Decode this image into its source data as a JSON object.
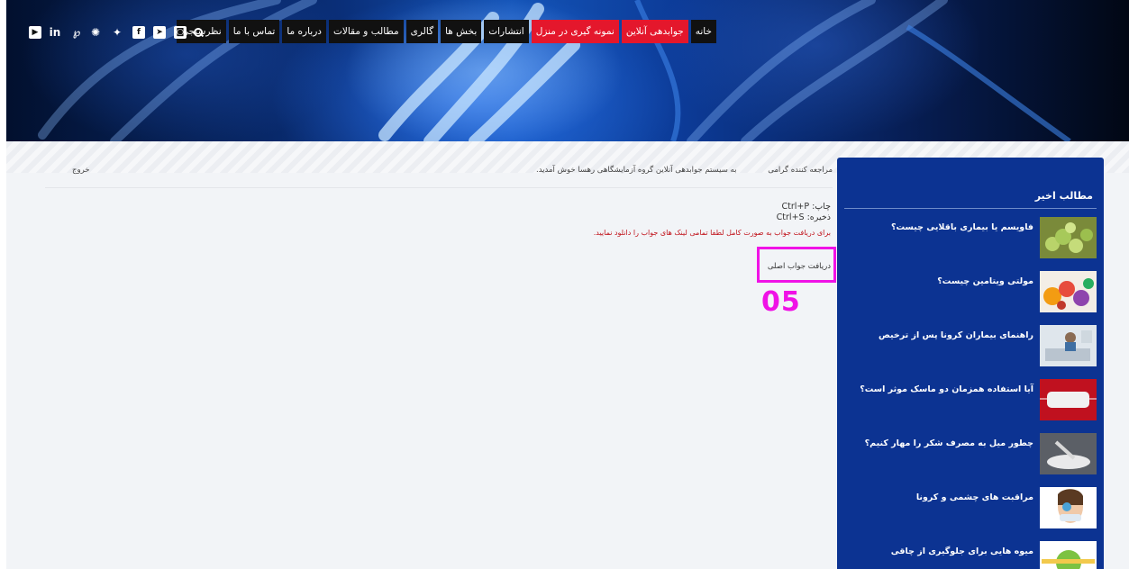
{
  "nav": {
    "items": [
      {
        "label": "خانه",
        "highlight": false
      },
      {
        "label": "جوابدهی آنلاین",
        "highlight": true
      },
      {
        "label": "نمونه گیری در منزل",
        "highlight": true
      },
      {
        "label": "انتشارات",
        "highlight": false
      },
      {
        "label": "بخش ها",
        "highlight": false
      },
      {
        "label": "گالری",
        "highlight": false
      },
      {
        "label": "مطالب و مقالات",
        "highlight": false
      },
      {
        "label": "درباره ما",
        "highlight": false
      },
      {
        "label": "تماس با ما",
        "highlight": false
      },
      {
        "label": "نظرسنجی",
        "highlight": false
      }
    ],
    "search_icon": "search-icon",
    "social_icons": [
      "instagram-icon",
      "telegram-icon",
      "facebook-icon",
      "twitter-icon",
      "aparat-icon",
      "pinterest-icon",
      "linkedin-icon",
      "youtube-icon"
    ],
    "accent_color": "#e4172c"
  },
  "welcome": {
    "dear_client": "مراجعه کننده گرامی",
    "message": "به سیستم جوابدهی آنلاین گروه آزمایشگاهی رهسا خوش آمدید.",
    "logout": "خروج"
  },
  "instructions": {
    "print": "چاپ: Ctrl+P",
    "save": "ذخیره: Ctrl+S",
    "download_note": "برای دریافت جواب به صورت کامل لطفا تمامی لینک های جواب را دانلود نمایید."
  },
  "answer": {
    "link_label": "دریافت جواب اصلی",
    "step_label": "05",
    "highlight_color": "#f012e6"
  },
  "sidebar": {
    "title": "مطالب اخیر",
    "posts": [
      {
        "title": "فاویسم یا بیماری باقلایی چیست؟",
        "thumb": "fava-beans"
      },
      {
        "title": "مولتی ویتامین چیست؟",
        "thumb": "fruits"
      },
      {
        "title": "راهنمای بیماران کرونا پس از ترخیص",
        "thumb": "patient"
      },
      {
        "title": "آیا استفاده همزمان دو ماسک موثر است؟",
        "thumb": "mask"
      },
      {
        "title": "چطور میل به مصرف شکر را مهار کنیم؟",
        "thumb": "sugar"
      },
      {
        "title": "مراقبت های چشمی و کرونا",
        "thumb": "eye-care"
      },
      {
        "title": "میوه هایی برای جلوگیری از چاقی",
        "thumb": "apple"
      }
    ],
    "color": "#0c3392"
  }
}
